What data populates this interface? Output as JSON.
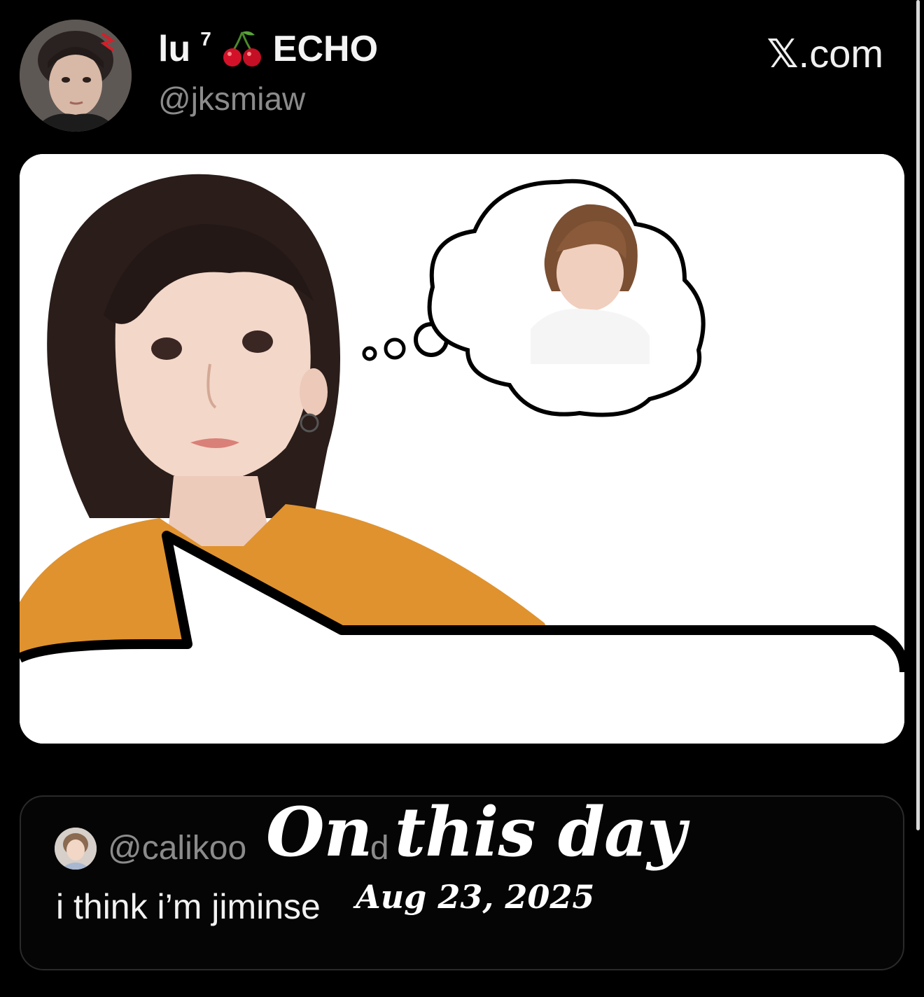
{
  "header": {
    "display_name": "lu",
    "superscript": "7",
    "name_suffix": "ECHO",
    "handle": "@jksmiaw",
    "site_logo": "𝕏",
    "site_domain": ".com"
  },
  "icons": {
    "cherry": "cherry-icon",
    "avatar": "avatar",
    "quote_avatar": "avatar"
  },
  "media": {
    "description_icon": "thought-bubble-meme"
  },
  "quote": {
    "handle": "@calikoo",
    "handle_tail": "d",
    "text": "i think i’m jiminse"
  },
  "overlay": {
    "title": "On this day",
    "date": "Aug 23, 2025"
  },
  "colors": {
    "background": "#000000",
    "card_background": "#ffffff",
    "muted_text": "#8b8b8b"
  }
}
